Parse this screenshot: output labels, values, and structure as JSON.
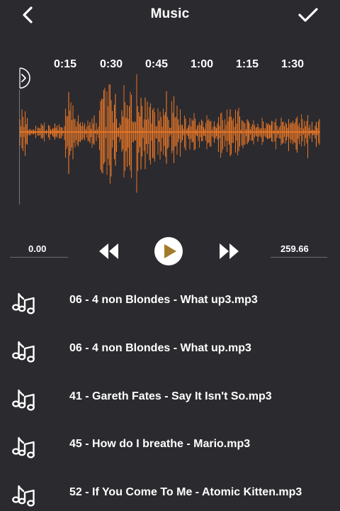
{
  "header": {
    "title": "Music",
    "back_icon": "chevron-left-icon",
    "done_icon": "checkmark-icon"
  },
  "timeline": {
    "ticks": [
      "0:15",
      "0:30",
      "0:45",
      "1:00",
      "1:15",
      "1:30"
    ]
  },
  "waveform": {
    "color": "#f57c27",
    "background": "#2b2a2f"
  },
  "controls": {
    "start_time": "0.00",
    "end_time": "259.66",
    "rewind_icon": "rewind-icon",
    "play_icon": "play-icon",
    "forward_icon": "fast-forward-icon",
    "play_color": "#a27a2a"
  },
  "tracks": [
    {
      "label": "06 - 4 non Blondes - What up3.mp3",
      "icon": "music-note-icon"
    },
    {
      "label": "06 - 4 non Blondes - What up.mp3",
      "icon": "music-note-icon"
    },
    {
      "label": "41 - Gareth Fates -  Say It Isn't So.mp3",
      "icon": "music-note-icon"
    },
    {
      "label": "45 - How do I breathe - Mario.mp3",
      "icon": "music-note-icon"
    },
    {
      "label": "52 - If You Come To Me - Atomic Kitten.mp3",
      "icon": "music-note-icon"
    }
  ]
}
